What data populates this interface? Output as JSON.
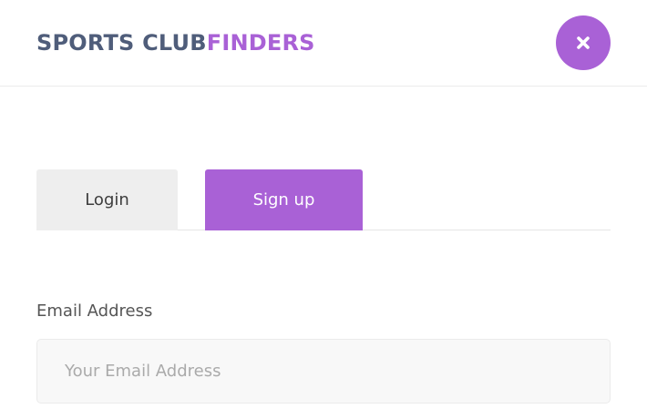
{
  "brand": {
    "name_part1": "SPORTS CLUB",
    "name_part2": "FINDERS",
    "primary_color": "#4f5d7a",
    "accent_color": "#a961d6"
  },
  "header": {
    "close_icon": "close-icon"
  },
  "tabs": [
    {
      "label": "Login",
      "active": false
    },
    {
      "label": "Sign up",
      "active": true
    }
  ],
  "form": {
    "email_label": "Email Address",
    "email_placeholder": "Your Email Address",
    "email_value": ""
  }
}
